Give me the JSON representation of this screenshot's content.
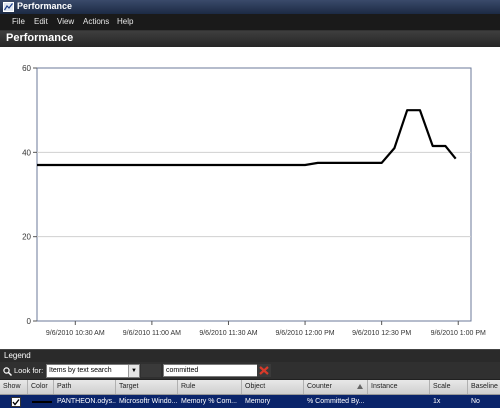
{
  "window": {
    "title": "Performance"
  },
  "menu": [
    "File",
    "Edit",
    "View",
    "Actions",
    "Help"
  ],
  "page_title": "Performance",
  "chart_data": {
    "type": "line",
    "x": [
      "10:15",
      "10:30",
      "10:45",
      "11:00",
      "11:15",
      "11:30",
      "11:45",
      "12:00",
      "12:05",
      "12:15",
      "12:30",
      "12:35",
      "12:40",
      "12:45",
      "12:50",
      "12:55",
      "12:59"
    ],
    "x_tick_labels": [
      "9/6/2010 10:30 AM",
      "9/6/2010 11:00 AM",
      "9/6/2010 11:30 AM",
      "9/6/2010 12:00 PM",
      "9/6/2010 12:30 PM",
      "9/6/2010 1:00 PM"
    ],
    "series": [
      {
        "values": [
          37,
          37,
          37,
          37,
          37,
          37,
          37,
          37,
          37.5,
          37.5,
          37.5,
          41,
          50,
          50,
          41.5,
          41.5,
          38.5
        ],
        "color": "#000000"
      }
    ],
    "xlim": [
      "10:15",
      "13:05"
    ],
    "ylim": [
      0,
      60
    ],
    "y_ticks": [
      0,
      20,
      40,
      60
    ],
    "grid": true
  },
  "legend": {
    "title": "Legend",
    "look_for_label": "Look for:",
    "search_mode": "Items by text search",
    "search_value": "committed",
    "columns": [
      "Show",
      "Color",
      "Path",
      "Target",
      "Rule",
      "Object",
      "Counter",
      "Instance",
      "Scale",
      "Baseline"
    ],
    "rows": [
      {
        "show": true,
        "color": "#000000",
        "path": "PANTHEON.odys...",
        "target": "Microsoftr Windo...",
        "rule": "Memory % Com...",
        "object": "Memory",
        "counter": "% Committed By...",
        "instance": "",
        "scale": "1x",
        "baseline": "No"
      }
    ]
  },
  "colors": {
    "title_bar": "#1c2a44",
    "menu_bar": "#1a1a1a",
    "selection": "#0a246a",
    "line": "#000000"
  }
}
